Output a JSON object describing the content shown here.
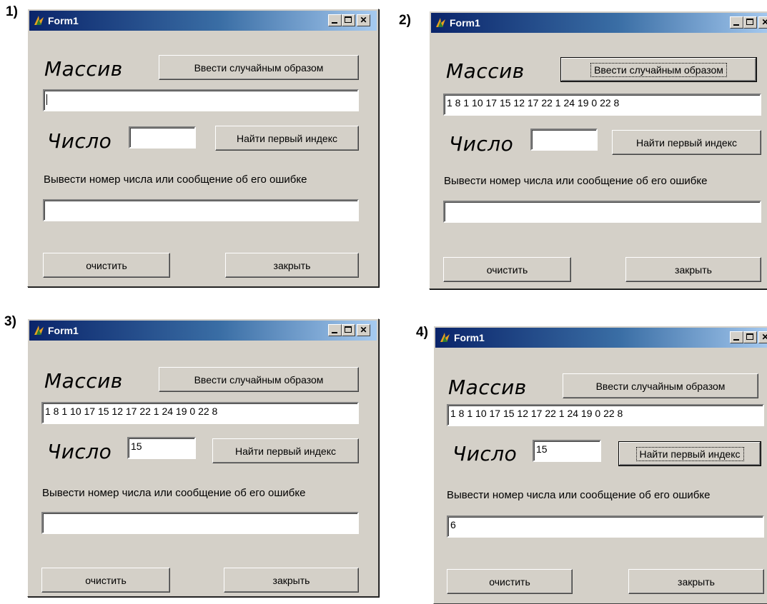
{
  "panels": [
    {
      "number": "1)",
      "title": "Form1",
      "massiv_label": "Массив",
      "random_button": "Ввести случайным образом",
      "array_value": "",
      "show_caret": true,
      "chislo_label": "Число",
      "number_value": "",
      "find_button": "Найти первый индекс",
      "message_label": "Вывести номер числа или сообщение об его ошибке",
      "result_value": "",
      "clear_button": "очистить",
      "close_button": "закрыть",
      "focused": ""
    },
    {
      "number": "2)",
      "title": "Form1",
      "massiv_label": "Массив",
      "random_button": "Ввести случайным образом",
      "array_value": "1 8 1 10 17 15 12 17 22 1 24 19 0 22 8",
      "show_caret": false,
      "chislo_label": "Число",
      "number_value": "",
      "find_button": "Найти первый индекс",
      "message_label": "Вывести номер числа или сообщение об его ошибке",
      "result_value": "",
      "clear_button": "очистить",
      "close_button": "закрыть",
      "focused": "random"
    },
    {
      "number": "3)",
      "title": "Form1",
      "massiv_label": "Массив",
      "random_button": "Ввести случайным образом",
      "array_value": "1 8 1 10 17 15 12 17 22 1 24 19 0 22 8",
      "show_caret": false,
      "chislo_label": "Число",
      "number_value": "15",
      "find_button": "Найти первый индекс",
      "message_label": "Вывести номер числа или сообщение об его ошибке",
      "result_value": "",
      "clear_button": "очистить",
      "close_button": "закрыть",
      "focused": ""
    },
    {
      "number": "4)",
      "title": "Form1",
      "massiv_label": "Массив",
      "random_button": "Ввести случайным образом",
      "array_value": "1 8 1 10 17 15 12 17 22 1 24 19 0 22 8",
      "show_caret": false,
      "chislo_label": "Число",
      "number_value": "15",
      "find_button": "Найти первый индекс",
      "message_label": "Вывести номер числа или сообщение об его ошибке",
      "result_value": "6",
      "clear_button": "очистить",
      "close_button": "закрыть",
      "focused": "find"
    }
  ],
  "colors": {
    "window_face": "#d4d0c8",
    "titlebar_start": "#0a246a",
    "titlebar_end": "#a6caf0"
  }
}
